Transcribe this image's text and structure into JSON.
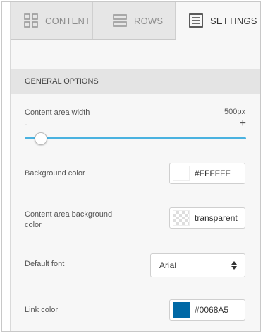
{
  "tabs": [
    {
      "label": "CONTENT",
      "icon": "grid-icon",
      "active": false
    },
    {
      "label": "ROWS",
      "icon": "rows-icon",
      "active": false
    },
    {
      "label": "SETTINGS",
      "icon": "document-icon",
      "active": true
    }
  ],
  "section": {
    "title": "GENERAL OPTIONS"
  },
  "content_width": {
    "label": "Content area width",
    "value": "500px",
    "minus": "-",
    "plus": "+",
    "slider_fraction": 0.07
  },
  "background_color": {
    "label": "Background color",
    "value": "#FFFFFF",
    "swatch": "#ffffff"
  },
  "content_bg_color": {
    "label": "Content area background color",
    "value": "transparent"
  },
  "default_font": {
    "label": "Default font",
    "value": "Arial"
  },
  "link_color": {
    "label": "Link color",
    "value": "#0068A5",
    "swatch": "#0068a5"
  },
  "colors": {
    "accent": "#4ab2e0",
    "tab_inactive": "#e6e6e6",
    "panel": "#f7f7f7",
    "section_header": "#e4e4e4"
  }
}
